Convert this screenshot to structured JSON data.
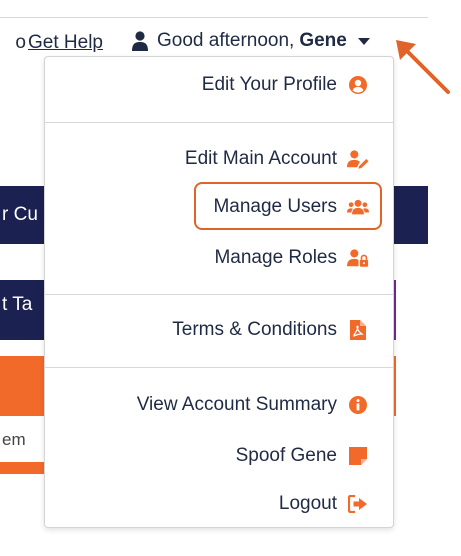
{
  "header": {
    "help_cut_text": "o",
    "help_link": "Get Help",
    "greeting_prefix": "Good afternoon,",
    "user_name": "Gene",
    "user_icon": "user-icon",
    "dropdown_icon": "caret-down-icon"
  },
  "background": {
    "navy_bar_text": "r Cu",
    "navy_box_text": "t Ta",
    "gray_text": "em"
  },
  "menu": {
    "items": [
      {
        "label": "Edit Your Profile",
        "icon": "user-circle-icon"
      },
      {
        "label": "Edit Main Account",
        "icon": "user-edit-icon"
      },
      {
        "label": "Manage Users",
        "icon": "users-icon",
        "highlighted": true
      },
      {
        "label": "Manage Roles",
        "icon": "user-lock-icon"
      },
      {
        "label": "Terms & Conditions",
        "icon": "file-pdf-icon"
      },
      {
        "label": "View Account Summary",
        "icon": "info-circle-icon"
      },
      {
        "label": "Spoof Gene",
        "icon": "sticky-note-icon"
      },
      {
        "label": "Logout",
        "icon": "sign-out-icon"
      }
    ]
  },
  "colors": {
    "accent": "#f26a2a",
    "text": "#1f2a44",
    "navy": "#1b2150",
    "highlight_border": "#e0642a"
  }
}
